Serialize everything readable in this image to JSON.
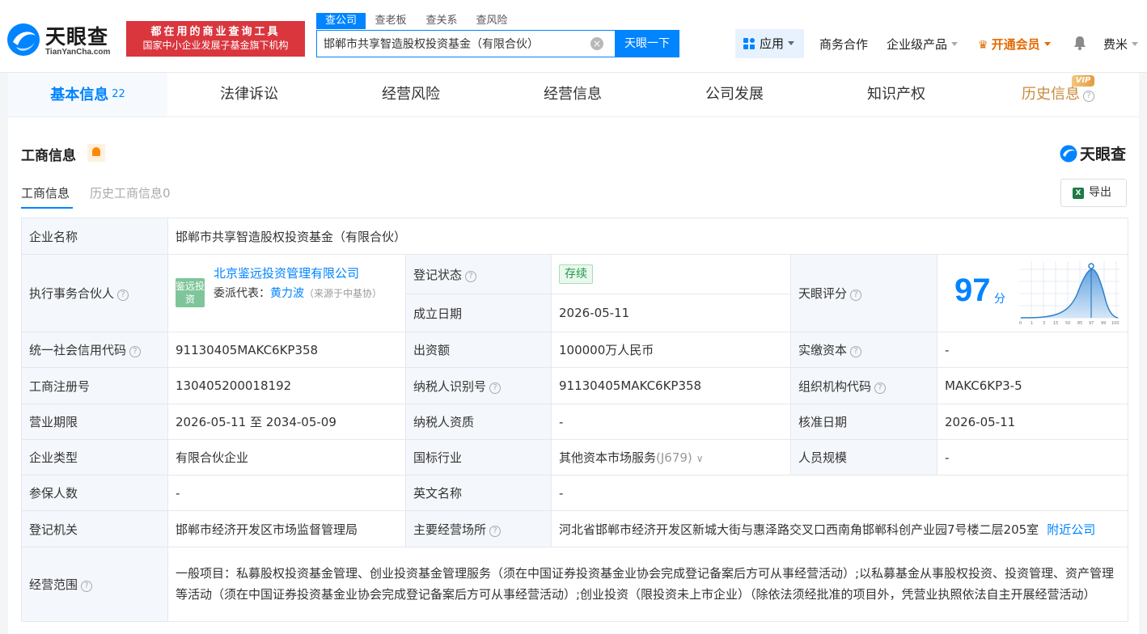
{
  "header": {
    "logo_text": "天眼查",
    "logo_sub": "TianYanCha.com",
    "slogan_line1": "都在用的商业查询工具",
    "slogan_line2": "国家中小企业发展子基金旗下机构",
    "search_tabs": [
      "查公司",
      "查老板",
      "查关系",
      "查风险"
    ],
    "search_value": "邯郸市共享智造股权投资基金（有限合伙）",
    "search_button": "天眼一下",
    "app_label": "应用",
    "nav_business": "商务合作",
    "nav_enterprise": "企业级产品",
    "nav_vip": "开通会员",
    "username": "费米"
  },
  "tabs": {
    "basic": "基本信息",
    "basic_count": "22",
    "legal": "法律诉讼",
    "risk": "经营风险",
    "operation": "经营信息",
    "development": "公司发展",
    "ip": "知识产权",
    "history": "历史信息",
    "vip_badge": "VIP"
  },
  "section": {
    "title": "工商信息",
    "brand": "天眼查",
    "subtab_current": "工商信息",
    "subtab_history": "历史工商信息0",
    "export": "导出"
  },
  "info": {
    "company_name_label": "企业名称",
    "company_name": "邯郸市共享智造股权投资基金（有限合伙）",
    "partner_label": "执行事务合伙人",
    "partner_logo": "鉴远投资",
    "partner_name": "北京鉴远投资管理有限公司",
    "rep_label": "委派代表：",
    "rep_name": "黄力波",
    "rep_source": "（来源于中基协）",
    "reg_status_label": "登记状态",
    "reg_status": "存续",
    "found_date_label": "成立日期",
    "found_date": "2026-05-11",
    "score_label": "天眼评分",
    "score": "97",
    "score_unit": "分",
    "score_axis": [
      "0",
      "1",
      "3",
      "15",
      "50",
      "85",
      "97",
      "99",
      "100"
    ],
    "credit_code_label": "统一社会信用代码",
    "credit_code": "91130405MAKC6KP358",
    "capital_label": "出资额",
    "capital": "100000万人民币",
    "paid_capital_label": "实缴资本",
    "paid_capital": "-",
    "reg_no_label": "工商注册号",
    "reg_no": "130405200018192",
    "taxpayer_id_label": "纳税人识别号",
    "taxpayer_id": "91130405MAKC6KP358",
    "org_code_label": "组织机构代码",
    "org_code": "MAKC6KP3-5",
    "term_label": "营业期限",
    "term": "2026-05-11 至 2034-05-09",
    "taxpayer_qual_label": "纳税人资质",
    "taxpayer_qual": "-",
    "approve_date_label": "核准日期",
    "approve_date": "2026-05-11",
    "type_label": "企业类型",
    "type": "有限合伙企业",
    "industry_label": "国标行业",
    "industry": "其他资本市场服务",
    "industry_code": "(J679)",
    "staff_label": "人员规模",
    "staff": "-",
    "insured_label": "参保人数",
    "insured": "-",
    "english_name_label": "英文名称",
    "english_name": "-",
    "authority_label": "登记机关",
    "authority": "邯郸市经济开发区市场监督管理局",
    "address_label": "主要经营场所",
    "address": "河北省邯郸市经济开发区新城大街与惠泽路交叉口西南角邯郸科创产业园7号楼二层205室",
    "nearby": "附近公司",
    "scope_label": "经营范围",
    "scope": "一般项目：私募股权投资基金管理、创业投资基金管理服务（须在中国证券投资基金业协会完成登记备案后方可从事经营活动）;以私募基金从事股权投资、投资管理、资产管理等活动（须在中国证券投资基金业协会完成登记备案后方可从事经营活动）;创业投资（限投资未上市企业）（除依法须经批准的项目外，凭营业执照依法自主开展经营活动）"
  },
  "colors": {
    "accent": "#0084ff",
    "slogan_bg": "#d9363e",
    "vip": "#e26a00",
    "status_green": "#1e9a4b"
  }
}
